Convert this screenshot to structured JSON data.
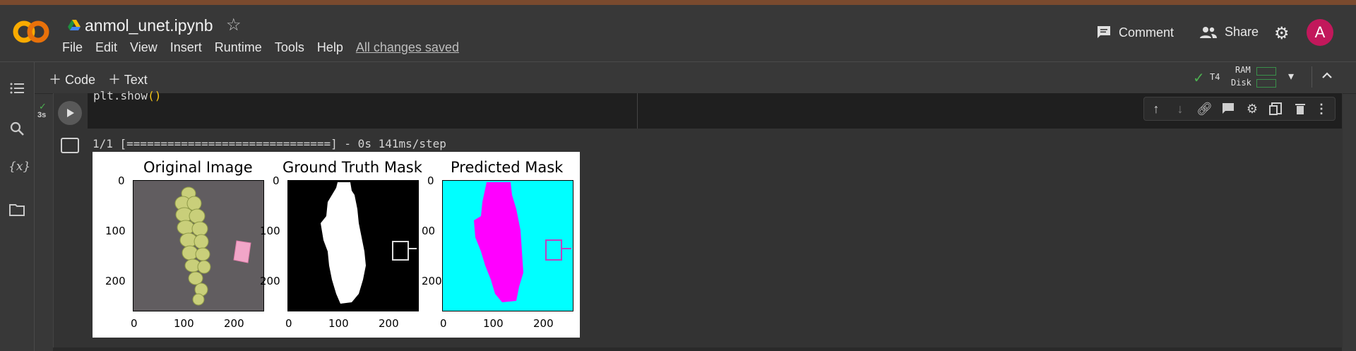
{
  "app": {
    "notebook_title": "anmol_unet.ipynb",
    "save_status": "All changes saved"
  },
  "menu": [
    "File",
    "Edit",
    "View",
    "Insert",
    "Runtime",
    "Tools",
    "Help"
  ],
  "header_actions": {
    "comment_label": "Comment",
    "share_label": "Share",
    "avatar_letter": "A"
  },
  "toolbar": {
    "add_code_label": "Code",
    "add_text_label": "Text",
    "runtime_type": "T4",
    "ram_label": "RAM",
    "disk_label": "Disk"
  },
  "cell": {
    "exec_time": "3s",
    "code_line": "plt.show",
    "code_parens": "()",
    "output_line": "1/1 [==============================] - 0s 141ms/step"
  },
  "figure": {
    "panels": [
      {
        "title": "Original Image"
      },
      {
        "title": "Ground Truth Mask"
      },
      {
        "title": "Predicted Mask"
      }
    ],
    "y_ticks": [
      "0",
      "100",
      "200"
    ],
    "y_ticks_clipped": [
      "0",
      "00",
      "200"
    ],
    "x_ticks": [
      "0",
      "100",
      "200"
    ]
  },
  "colors": {
    "cyan_background": "#00ffff",
    "magenta_mask": "#ff00ff",
    "avatar": "#c2185b",
    "check": "#4caf50"
  }
}
